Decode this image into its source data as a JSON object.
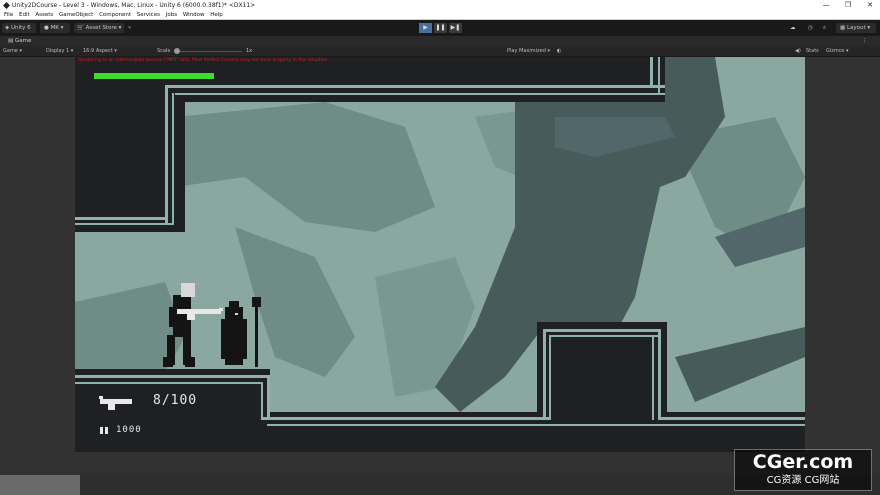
{
  "titlebar": {
    "title": "Unity2DCourse - Level 3 - Windows, Mac, Linux - Unity 6 (6000.0.38f1)* <DX11>",
    "minimize": "—",
    "maximize": "❐",
    "close": "✕"
  },
  "menubar": {
    "items": [
      "File",
      "Edit",
      "Assets",
      "GameObject",
      "Component",
      "Services",
      "Jobs",
      "Window",
      "Help"
    ]
  },
  "toolbar": {
    "unity_label": "Unity 6",
    "account": "MK",
    "asset_store": "Asset Store",
    "layout": "Layout",
    "play_icon": "play-icon",
    "pause_icon": "pause-icon",
    "step_icon": "step-icon"
  },
  "tabs": {
    "game": "Game"
  },
  "game_toolbar": {
    "view": "Game",
    "display": "Display 1",
    "aspect": "16:9 Aspect",
    "scale_label": "Scale",
    "scale_value": "1x",
    "play_mode": "Play Maximized",
    "stats": "Stats",
    "gizmos": "Gizmos"
  },
  "game": {
    "error_text": "Rendering to an intermediate texture (\"MRT\" blit). Pixel Perfect Camera may not work properly in this situation.",
    "health_fraction": 1.0,
    "health_color": "#3ddc2e",
    "ammo": "8/100",
    "count": "1000",
    "bg_colors": {
      "light": "#8aa8a0",
      "mid": "#6f8c86",
      "dark": "#485b5b",
      "wall": "#1f2023",
      "trim": "#8fb3a8"
    }
  },
  "watermark": {
    "line1": "CGer.com",
    "line2": "CG资源 CG网站"
  }
}
